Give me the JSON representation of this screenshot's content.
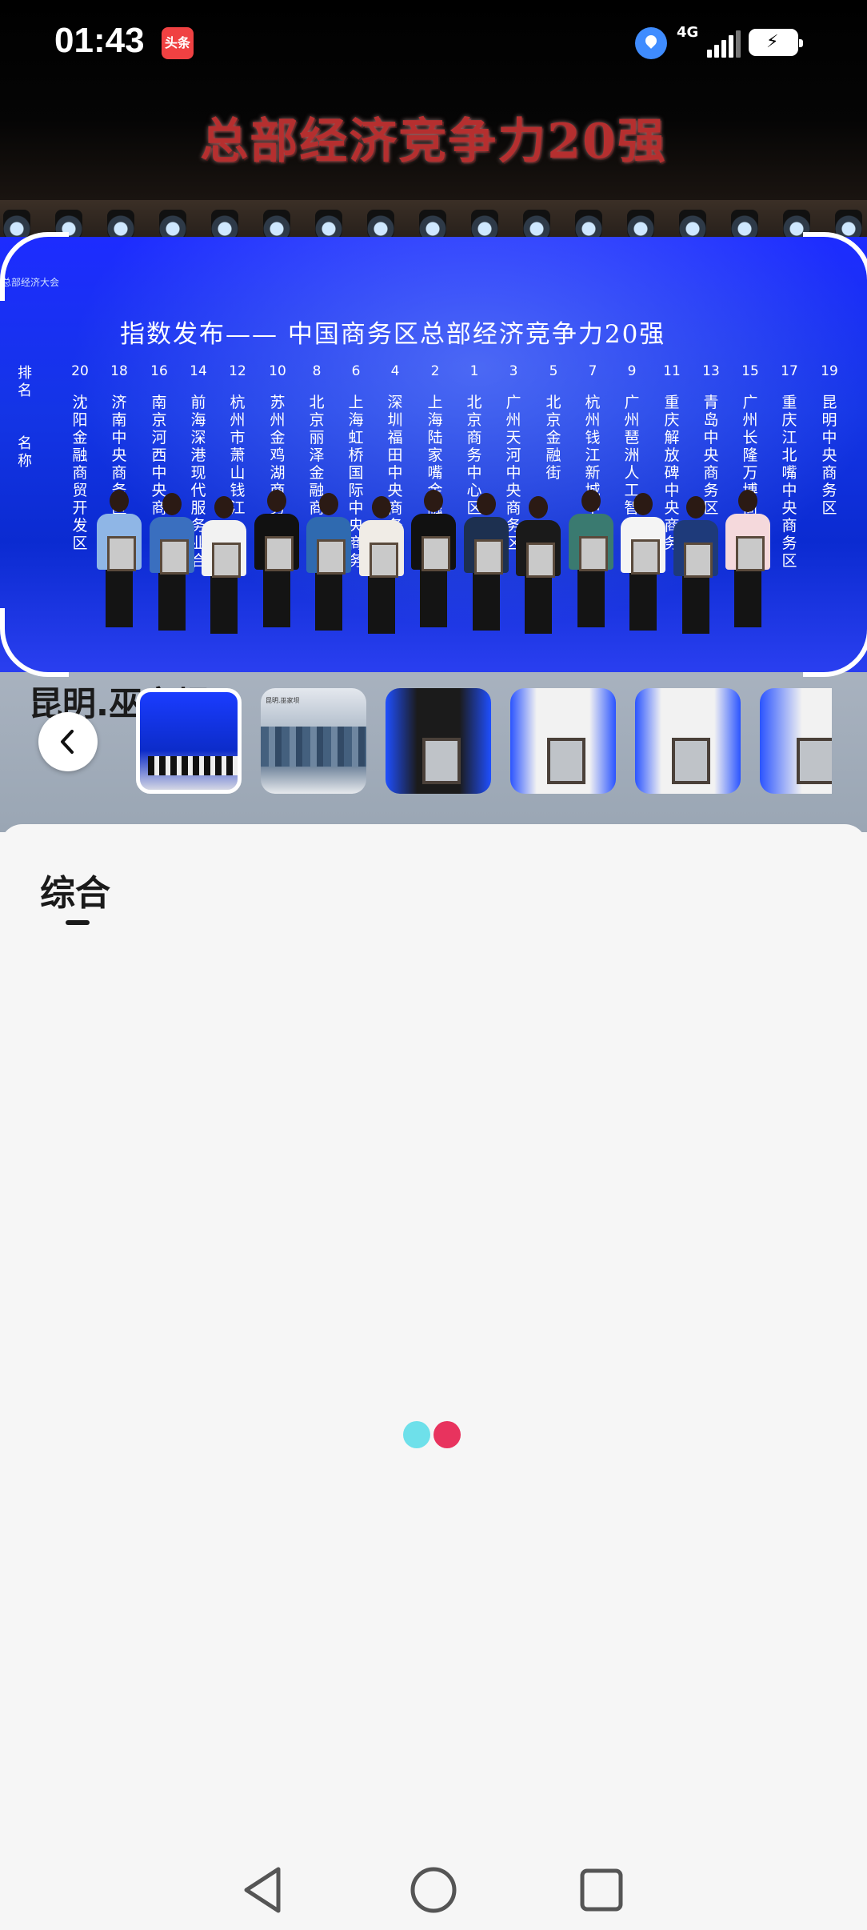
{
  "status_bar": {
    "time": "01:43",
    "app_badge": "头条",
    "network": "4G",
    "icons": [
      "location-icon",
      "signal-icon",
      "battery-charging-icon"
    ]
  },
  "photo": {
    "caption": "总部经济竞争力20强",
    "board_title": "指数发布—— 中国商务区总部经济竞争力20强",
    "board_corner_text": "总部经济大会",
    "rank_label": "排名",
    "name_label": "名称",
    "columns": [
      {
        "rank": "20",
        "name": "沈阳金融商贸开发区"
      },
      {
        "rank": "18",
        "name": "济南中央商务区"
      },
      {
        "rank": "16",
        "name": "南京河西中央商务区"
      },
      {
        "rank": "14",
        "name": "前海深港现代服务业合"
      },
      {
        "rank": "12",
        "name": "杭州市萧山钱江"
      },
      {
        "rank": "10",
        "name": "苏州金鸡湖商务区"
      },
      {
        "rank": "8",
        "name": "北京丽泽金融商务区"
      },
      {
        "rank": "6",
        "name": "上海虹桥国际中央商务"
      },
      {
        "rank": "4",
        "name": "深圳福田中央商务"
      },
      {
        "rank": "2",
        "name": "上海陆家嘴金融"
      },
      {
        "rank": "1",
        "name": "北京商务中心区"
      },
      {
        "rank": "3",
        "name": "广州天河中央商务区"
      },
      {
        "rank": "5",
        "name": "北京金融街"
      },
      {
        "rank": "7",
        "name": "杭州钱江新城中"
      },
      {
        "rank": "9",
        "name": "广州琶洲人工智能与"
      },
      {
        "rank": "11",
        "name": "重庆解放碑中央商务"
      },
      {
        "rank": "13",
        "name": "青岛中央商务区"
      },
      {
        "rank": "15",
        "name": "广州长隆万博商务"
      },
      {
        "rank": "17",
        "name": "重庆江北嘴中央商务区"
      },
      {
        "rank": "19",
        "name": "昆明中央商务区"
      }
    ],
    "background_text": "昆明.巫家坝"
  },
  "thumbnails": [
    {
      "label": "photo-1",
      "selected": true
    },
    {
      "label": "photo-2",
      "selected": false,
      "tiny_text": "昆明.巫家坝"
    },
    {
      "label": "photo-3",
      "selected": false
    },
    {
      "label": "photo-4",
      "selected": false
    },
    {
      "label": "photo-5",
      "selected": false
    },
    {
      "label": "photo-6",
      "selected": false
    }
  ],
  "sheet": {
    "tab_label": "综合"
  },
  "colors": {
    "loader_dot_a": "#6ee0ea",
    "loader_dot_b": "#e8335e",
    "caption_red": "#b52f2f",
    "badge_red": "#f04142"
  },
  "nav_bar": {
    "icons": [
      "nav-back-icon",
      "nav-home-icon",
      "nav-recents-icon"
    ]
  }
}
